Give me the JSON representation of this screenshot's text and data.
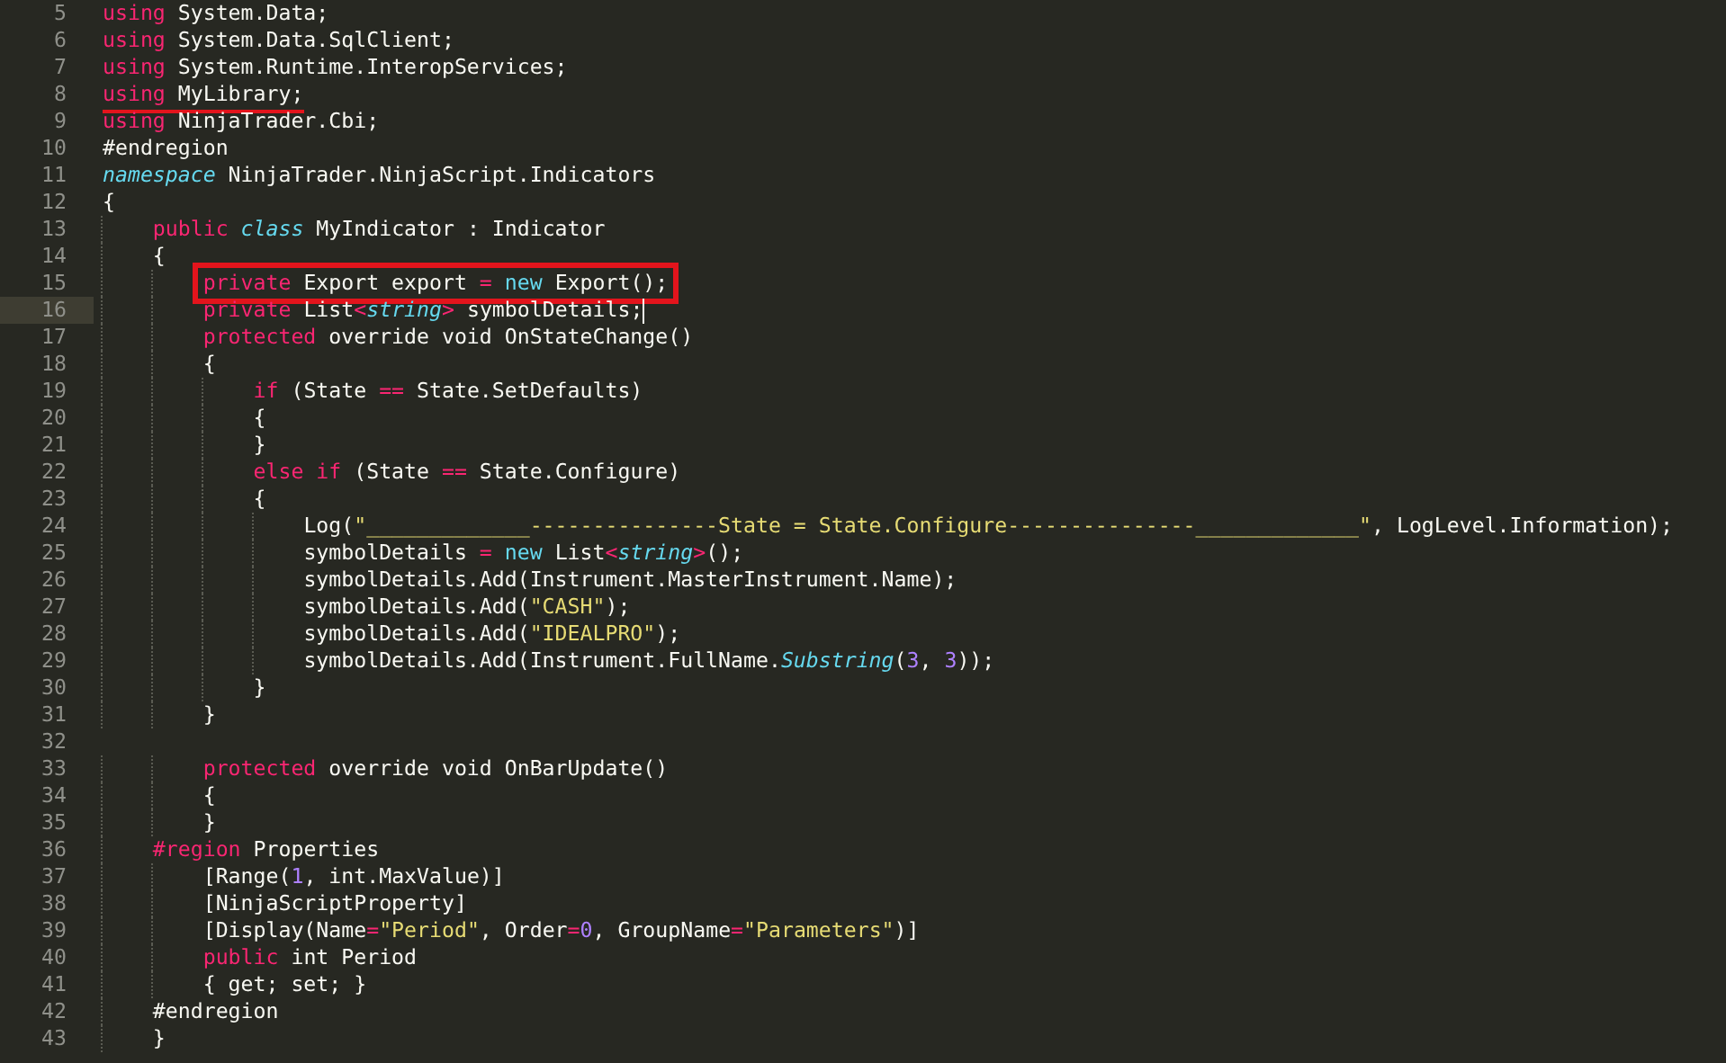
{
  "editor": {
    "lines": [
      {
        "n": "5",
        "current": false,
        "underlined": false,
        "boxed": false,
        "tokens": [
          {
            "kind": "kw",
            "text": "using"
          },
          {
            "kind": "txt",
            "text": " System.Data;"
          }
        ]
      },
      {
        "n": "6",
        "current": false,
        "underlined": false,
        "boxed": false,
        "tokens": [
          {
            "kind": "kw",
            "text": "using"
          },
          {
            "kind": "txt",
            "text": " System.Data.SqlClient;"
          }
        ]
      },
      {
        "n": "7",
        "current": false,
        "underlined": false,
        "boxed": false,
        "tokens": [
          {
            "kind": "kw",
            "text": "using"
          },
          {
            "kind": "txt",
            "text": " System.Runtime.InteropServices;"
          }
        ]
      },
      {
        "n": "8",
        "current": false,
        "underlined": true,
        "boxed": false,
        "tokens": [
          {
            "kind": "kw",
            "text": "using"
          },
          {
            "kind": "txt",
            "text": " MyLibrary;"
          }
        ]
      },
      {
        "n": "9",
        "current": false,
        "underlined": false,
        "boxed": false,
        "tokens": [
          {
            "kind": "kw",
            "text": "using"
          },
          {
            "kind": "txt",
            "text": " NinjaTrader.Cbi;"
          }
        ]
      },
      {
        "n": "10",
        "current": false,
        "underlined": false,
        "boxed": false,
        "tokens": [
          {
            "kind": "txt",
            "text": "#endregion"
          }
        ]
      },
      {
        "n": "11",
        "current": false,
        "underlined": false,
        "boxed": false,
        "tokens": [
          {
            "kind": "type",
            "text": "namespace"
          },
          {
            "kind": "txt",
            "text": " NinjaTrader.NinjaScript.Indicators"
          }
        ]
      },
      {
        "n": "12",
        "current": false,
        "underlined": false,
        "boxed": false,
        "tokens": [
          {
            "kind": "txt",
            "text": "{"
          }
        ]
      },
      {
        "n": "13",
        "current": false,
        "underlined": false,
        "boxed": false,
        "tokens": [
          {
            "kind": "kw",
            "text": "    public "
          },
          {
            "kind": "type",
            "text": "class"
          },
          {
            "kind": "txt",
            "text": " MyIndicator : Indicator"
          }
        ]
      },
      {
        "n": "14",
        "current": false,
        "underlined": false,
        "boxed": false,
        "tokens": [
          {
            "kind": "txt",
            "text": "    {"
          }
        ]
      },
      {
        "n": "15",
        "current": false,
        "underlined": false,
        "boxed": true,
        "tokens": [
          {
            "kind": "kw",
            "text": "        private"
          },
          {
            "kind": "txt",
            "text": " Export export "
          },
          {
            "kind": "op",
            "text": "= "
          },
          {
            "kind": "new",
            "text": "new"
          },
          {
            "kind": "txt",
            "text": " Export();"
          }
        ]
      },
      {
        "n": "16",
        "current": true,
        "underlined": false,
        "boxed": false,
        "tokens": [
          {
            "kind": "kw",
            "text": "        private"
          },
          {
            "kind": "txt",
            "text": " List"
          },
          {
            "kind": "op",
            "text": "<"
          },
          {
            "kind": "type",
            "text": "string"
          },
          {
            "kind": "op",
            "text": ">"
          },
          {
            "kind": "txt",
            "text": " symbolDetails;"
          }
        ]
      },
      {
        "n": "17",
        "current": false,
        "underlined": false,
        "boxed": false,
        "tokens": [
          {
            "kind": "kw",
            "text": "        protected"
          },
          {
            "kind": "txt",
            "text": " override void OnStateChange()"
          }
        ]
      },
      {
        "n": "18",
        "current": false,
        "underlined": false,
        "boxed": false,
        "tokens": [
          {
            "kind": "txt",
            "text": "        {"
          }
        ]
      },
      {
        "n": "19",
        "current": false,
        "underlined": false,
        "boxed": false,
        "tokens": [
          {
            "kind": "kw",
            "text": "            if"
          },
          {
            "kind": "txt",
            "text": " (State "
          },
          {
            "kind": "op",
            "text": "=="
          },
          {
            "kind": "txt",
            "text": " State.SetDefaults)"
          }
        ]
      },
      {
        "n": "20",
        "current": false,
        "underlined": false,
        "boxed": false,
        "tokens": [
          {
            "kind": "txt",
            "text": "            {"
          }
        ]
      },
      {
        "n": "21",
        "current": false,
        "underlined": false,
        "boxed": false,
        "tokens": [
          {
            "kind": "txt",
            "text": "            }"
          }
        ]
      },
      {
        "n": "22",
        "current": false,
        "underlined": false,
        "boxed": false,
        "tokens": [
          {
            "kind": "kw",
            "text": "            else if"
          },
          {
            "kind": "txt",
            "text": " (State "
          },
          {
            "kind": "op",
            "text": "=="
          },
          {
            "kind": "txt",
            "text": " State.Configure)"
          }
        ]
      },
      {
        "n": "23",
        "current": false,
        "underlined": false,
        "boxed": false,
        "tokens": [
          {
            "kind": "txt",
            "text": "            {"
          }
        ]
      },
      {
        "n": "24",
        "current": false,
        "underlined": false,
        "boxed": false,
        "tokens": [
          {
            "kind": "txt",
            "text": "                Log("
          },
          {
            "kind": "str",
            "text": "\"_____________---------------State = State.Configure---------------_____________\""
          },
          {
            "kind": "txt",
            "text": ", LogLevel.Information);"
          }
        ]
      },
      {
        "n": "25",
        "current": false,
        "underlined": false,
        "boxed": false,
        "tokens": [
          {
            "kind": "txt",
            "text": "                symbolDetails "
          },
          {
            "kind": "op",
            "text": "= "
          },
          {
            "kind": "new",
            "text": "new"
          },
          {
            "kind": "txt",
            "text": " List"
          },
          {
            "kind": "op",
            "text": "<"
          },
          {
            "kind": "type",
            "text": "string"
          },
          {
            "kind": "op",
            "text": ">"
          },
          {
            "kind": "txt",
            "text": "();"
          }
        ]
      },
      {
        "n": "26",
        "current": false,
        "underlined": false,
        "boxed": false,
        "tokens": [
          {
            "kind": "txt",
            "text": "                symbolDetails.Add(Instrument.MasterInstrument.Name);"
          }
        ]
      },
      {
        "n": "27",
        "current": false,
        "underlined": false,
        "boxed": false,
        "tokens": [
          {
            "kind": "txt",
            "text": "                symbolDetails.Add("
          },
          {
            "kind": "str",
            "text": "\"CASH\""
          },
          {
            "kind": "txt",
            "text": ");"
          }
        ]
      },
      {
        "n": "28",
        "current": false,
        "underlined": false,
        "boxed": false,
        "tokens": [
          {
            "kind": "txt",
            "text": "                symbolDetails.Add("
          },
          {
            "kind": "str",
            "text": "\"IDEALPRO\""
          },
          {
            "kind": "txt",
            "text": ");"
          }
        ]
      },
      {
        "n": "29",
        "current": false,
        "underlined": false,
        "boxed": false,
        "tokens": [
          {
            "kind": "txt",
            "text": "                symbolDetails.Add(Instrument.FullName."
          },
          {
            "kind": "type",
            "text": "Substring"
          },
          {
            "kind": "txt",
            "text": "("
          },
          {
            "kind": "num",
            "text": "3"
          },
          {
            "kind": "txt",
            "text": ", "
          },
          {
            "kind": "num",
            "text": "3"
          },
          {
            "kind": "txt",
            "text": "));"
          }
        ]
      },
      {
        "n": "30",
        "current": false,
        "underlined": false,
        "boxed": false,
        "tokens": [
          {
            "kind": "txt",
            "text": "            }"
          }
        ]
      },
      {
        "n": "31",
        "current": false,
        "underlined": false,
        "boxed": false,
        "tokens": [
          {
            "kind": "txt",
            "text": "        }"
          }
        ]
      },
      {
        "n": "32",
        "current": false,
        "underlined": false,
        "boxed": false
      },
      {
        "n": "33",
        "current": false,
        "underlined": false,
        "boxed": false,
        "tokens": [
          {
            "kind": "kw",
            "text": "        protected"
          },
          {
            "kind": "txt",
            "text": " override void OnBarUpdate()"
          }
        ]
      },
      {
        "n": "34",
        "current": false,
        "underlined": false,
        "boxed": false,
        "tokens": [
          {
            "kind": "txt",
            "text": "        {"
          }
        ]
      },
      {
        "n": "35",
        "current": false,
        "underlined": false,
        "boxed": false,
        "tokens": [
          {
            "kind": "txt",
            "text": "        }"
          }
        ]
      },
      {
        "n": "36",
        "current": false,
        "underlined": false,
        "boxed": false,
        "tokens": [
          {
            "kind": "kw",
            "text": "    #region"
          },
          {
            "kind": "txt",
            "text": " Properties"
          }
        ]
      },
      {
        "n": "37",
        "current": false,
        "underlined": false,
        "boxed": false,
        "tokens": [
          {
            "kind": "txt",
            "text": "        [Range("
          },
          {
            "kind": "num",
            "text": "1"
          },
          {
            "kind": "txt",
            "text": ", int.MaxValue)]"
          }
        ]
      },
      {
        "n": "38",
        "current": false,
        "underlined": false,
        "boxed": false,
        "tokens": [
          {
            "kind": "txt",
            "text": "        [NinjaScriptProperty]"
          }
        ]
      },
      {
        "n": "39",
        "current": false,
        "underlined": false,
        "boxed": false,
        "tokens": [
          {
            "kind": "txt",
            "text": "        [Display(Name"
          },
          {
            "kind": "op",
            "text": "="
          },
          {
            "kind": "str",
            "text": "\"Period\""
          },
          {
            "kind": "txt",
            "text": ", Order"
          },
          {
            "kind": "op",
            "text": "="
          },
          {
            "kind": "num",
            "text": "0"
          },
          {
            "kind": "txt",
            "text": ", GroupName"
          },
          {
            "kind": "op",
            "text": "="
          },
          {
            "kind": "str",
            "text": "\"Parameters\""
          },
          {
            "kind": "txt",
            "text": ")]"
          }
        ]
      },
      {
        "n": "40",
        "current": false,
        "underlined": false,
        "boxed": false,
        "tokens": [
          {
            "kind": "kw",
            "text": "        public"
          },
          {
            "kind": "txt",
            "text": " int Period"
          }
        ]
      },
      {
        "n": "41",
        "current": false,
        "underlined": false,
        "boxed": false,
        "tokens": [
          {
            "kind": "txt",
            "text": "        { get; set; }"
          }
        ]
      },
      {
        "n": "42",
        "current": false,
        "underlined": false,
        "boxed": false,
        "tokens": [
          {
            "kind": "txt",
            "text": "    #endregion"
          }
        ]
      },
      {
        "n": "43",
        "current": false,
        "underlined": false,
        "boxed": false,
        "tokens": [
          {
            "kind": "txt",
            "text": "    }"
          }
        ]
      }
    ]
  }
}
